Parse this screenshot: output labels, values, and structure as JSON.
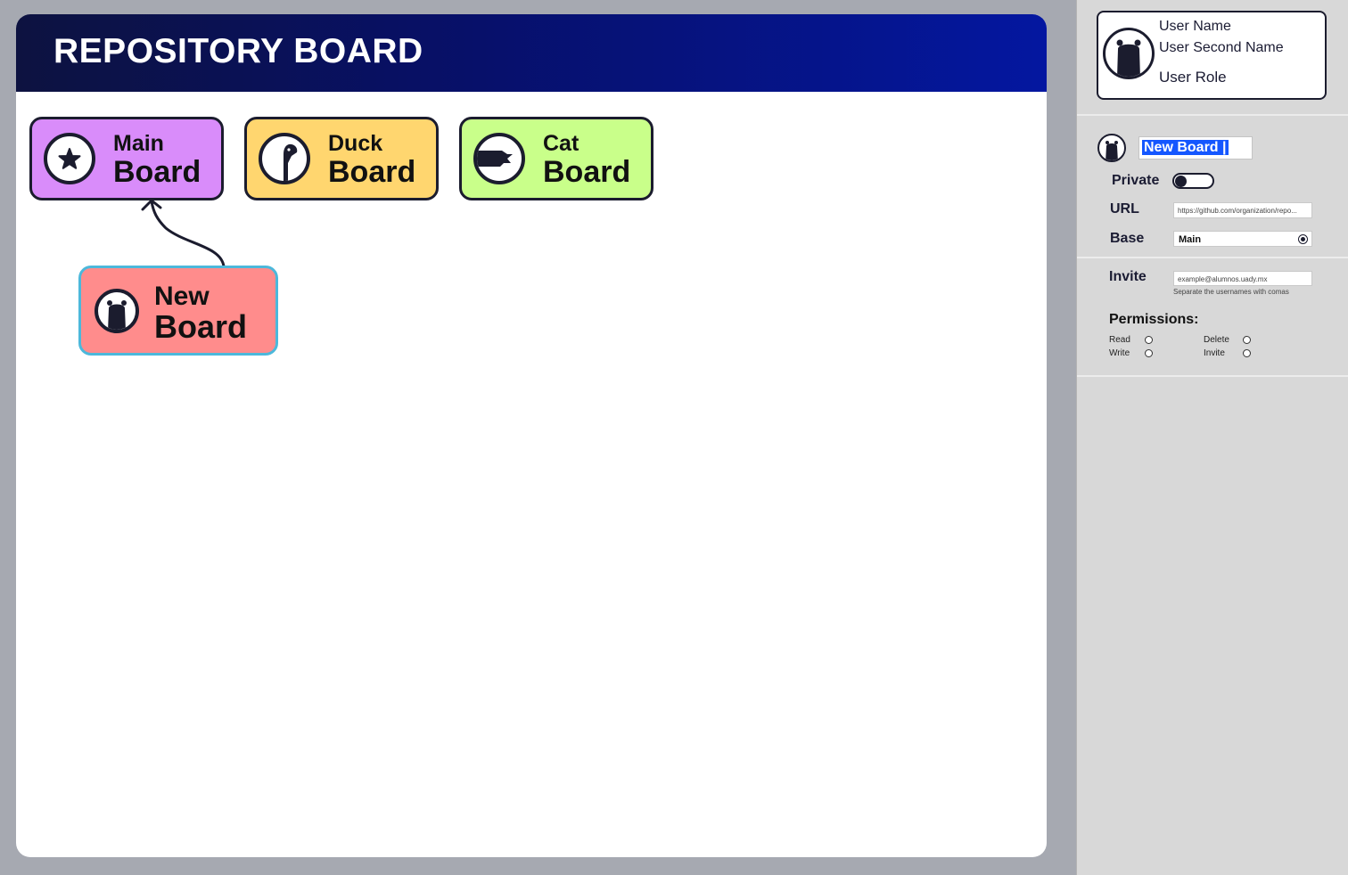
{
  "board": {
    "title": "REPOSITORY BOARD",
    "cards": {
      "main": {
        "line1": "Main",
        "line2": "Board",
        "color": "#d98cfa",
        "icon": "star-icon"
      },
      "duck": {
        "line1": "Duck",
        "line2": "Board",
        "color": "#ffd66f",
        "icon": "duck-icon"
      },
      "cat": {
        "line1": "Cat",
        "line2": "Board",
        "color": "#c9ff8a",
        "icon": "cat-icon"
      },
      "new": {
        "line1": "New",
        "line2": "Board",
        "color": "#ff8c8c",
        "icon": "bear-icon"
      }
    }
  },
  "user": {
    "name": "User Name",
    "second_name": "User Second Name",
    "role": "User Role",
    "avatar_icon": "bear-icon"
  },
  "form": {
    "board_name_value": "New Board |",
    "private_label": "Private",
    "private_on": false,
    "url_label": "URL",
    "url_placeholder": "https://github.com/organization/repo...",
    "base_label": "Base",
    "base_value": "Main",
    "invite_label": "Invite",
    "invite_placeholder": "example@alumnos.uady.mx",
    "invite_hint": "Separate the usernames with comas",
    "permissions_title": "Permissions:",
    "permissions": {
      "read": "Read",
      "write": "Write",
      "delete": "Delete",
      "invite": "Invite"
    }
  },
  "colors": {
    "header_gradient_start": "#0d1240",
    "header_gradient_end": "#0417a0",
    "selection_blue": "#1557ff",
    "new_card_border": "#4cb8db",
    "ink": "#1b1c2e"
  }
}
